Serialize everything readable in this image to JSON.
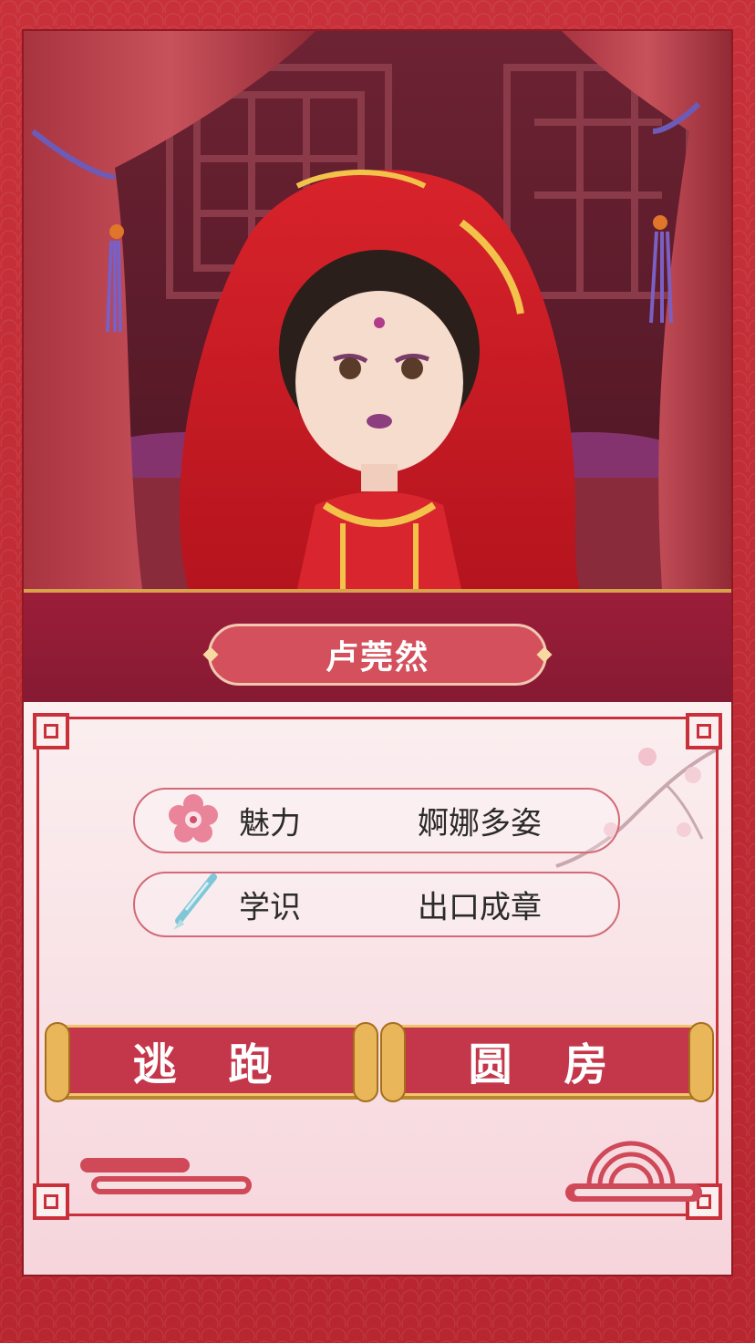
{
  "character": {
    "name": "卢莞然"
  },
  "stats": [
    {
      "label": "魅力",
      "value": "婀娜多姿",
      "icon": "plum-blossom-icon"
    },
    {
      "label": "学识",
      "value": "出口成章",
      "icon": "brush-icon"
    }
  ],
  "actions": {
    "escape_label": "逃 跑",
    "consummate_label": "圆 房"
  },
  "colors": {
    "frame_red": "#c8313a",
    "band_crimson": "#9c1d39",
    "plate_pink": "#d4505c",
    "button_red": "#c4374a",
    "gold": "#f0c56b"
  }
}
